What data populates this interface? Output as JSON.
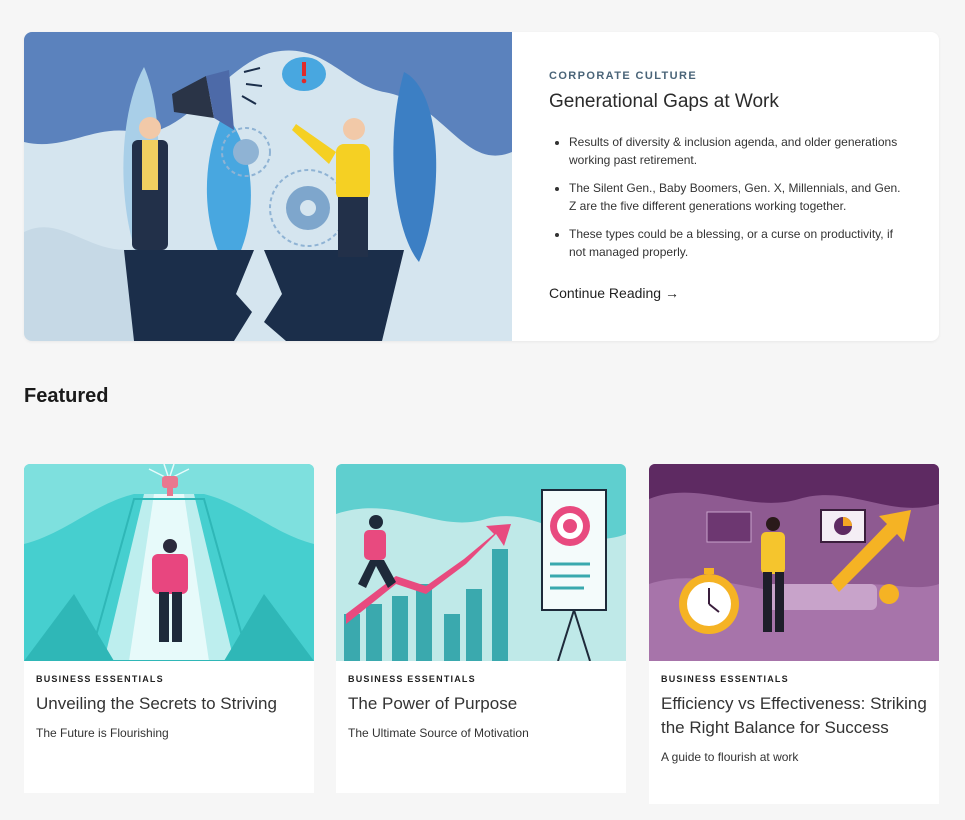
{
  "hero": {
    "category": "CORPORATE CULTURE",
    "title": "Generational Gaps at Work",
    "bullets": [
      "Results of diversity & inclusion agenda, and older generations working past retirement.",
      "The Silent Gen., Baby Boomers, Gen. X, Millennials, and Gen. Z are the five different generations working together.",
      "These types could be a blessing, or a curse on productivity, if not managed properly."
    ],
    "cta": "Continue Reading →",
    "image_icon": "megaphone-illustration"
  },
  "featured": {
    "heading": "Featured",
    "cards": [
      {
        "category": "BUSINESS ESSENTIALS",
        "title": "Unveiling the Secrets to Striving",
        "subtitle": "The Future is Flourishing",
        "image_icon": "stairs-trophy-illustration"
      },
      {
        "category": "BUSINESS ESSENTIALS",
        "title": "The Power of Purpose",
        "subtitle": "The Ultimate Source of Motivation",
        "image_icon": "target-chart-illustration"
      },
      {
        "category": "BUSINESS ESSENTIALS",
        "title": "Efficiency vs Effectiveness: Striking the Right Balance for Success",
        "subtitle": "A guide to flourish at work",
        "image_icon": "stopwatch-conveyor-illustration"
      }
    ]
  },
  "colors": {
    "accent": "#4a6478",
    "teal": "#3fc9c9",
    "purple": "#6a2f6e",
    "orange": "#f5a623",
    "pink": "#e84a7f"
  }
}
